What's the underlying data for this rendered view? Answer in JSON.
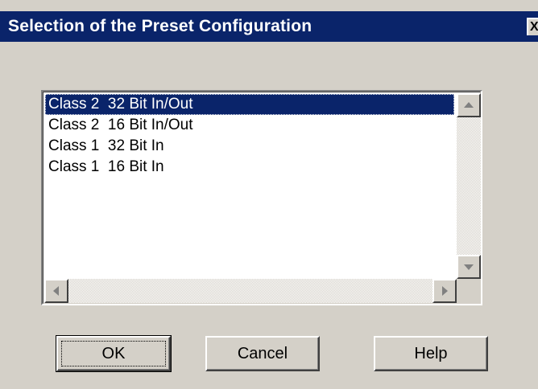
{
  "window": {
    "title": "Selection of the Preset Configuration",
    "close_glyph": "X"
  },
  "list": {
    "items": [
      {
        "label": "Class 2  32 Bit In/Out",
        "selected": true
      },
      {
        "label": "Class 2  16 Bit In/Out",
        "selected": false
      },
      {
        "label": "Class 1  32 Bit In",
        "selected": false
      },
      {
        "label": "Class 1  16 Bit In",
        "selected": false
      }
    ]
  },
  "buttons": {
    "ok": "OK",
    "cancel": "Cancel",
    "help": "Help"
  },
  "colors": {
    "titlebar": "#0a246a",
    "face": "#d4d0c8",
    "selection": "#0a246a"
  }
}
